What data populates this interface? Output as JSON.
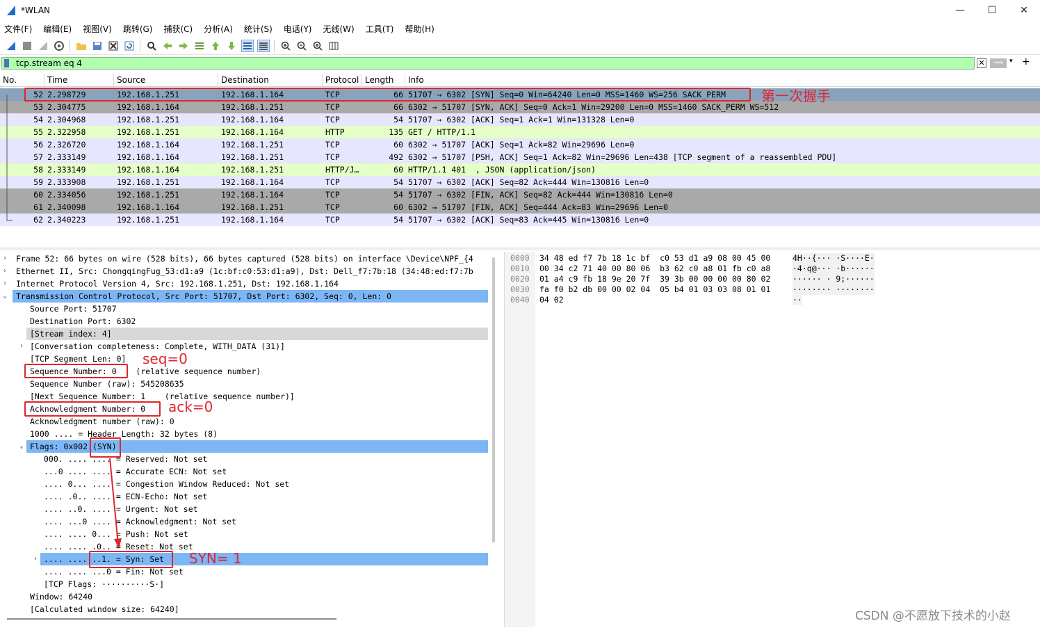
{
  "window": {
    "title": "*WLAN",
    "controls": [
      "—",
      "☐",
      "✕"
    ]
  },
  "menu": [
    "文件(F)",
    "编辑(E)",
    "视图(V)",
    "跳转(G)",
    "捕获(C)",
    "分析(A)",
    "统计(S)",
    "电话(Y)",
    "无线(W)",
    "工具(T)",
    "帮助(H)"
  ],
  "filter": {
    "value": "tcp.stream eq 4",
    "clear_glyph": "✕",
    "apply_glyph": "⟹",
    "dropdown_glyph": "▾",
    "add_glyph": "+"
  },
  "packet_list": {
    "columns": [
      "No.",
      "Time",
      "Source",
      "Destination",
      "Protocol",
      "Length",
      "Info"
    ],
    "rows": [
      {
        "no": "52",
        "time": "2.298729",
        "src": "192.168.1.251",
        "dst": "192.168.1.164",
        "proto": "TCP",
        "len": "66",
        "info": "51707 → 6302 [SYN] Seq=0 Win=64240 Len=0 MSS=1460 WS=256 SACK_PERM",
        "style": "selected"
      },
      {
        "no": "53",
        "time": "2.304775",
        "src": "192.168.1.164",
        "dst": "192.168.1.251",
        "proto": "TCP",
        "len": "66",
        "info": "6302 → 51707 [SYN, ACK] Seq=0 Ack=1 Win=29200 Len=0 MSS=1460 SACK_PERM WS=512",
        "style": "gray"
      },
      {
        "no": "54",
        "time": "2.304968",
        "src": "192.168.1.251",
        "dst": "192.168.1.164",
        "proto": "TCP",
        "len": "54",
        "info": "51707 → 6302 [ACK] Seq=1 Ack=1 Win=131328 Len=0",
        "style": "lavender"
      },
      {
        "no": "55",
        "time": "2.322958",
        "src": "192.168.1.251",
        "dst": "192.168.1.164",
        "proto": "HTTP",
        "len": "135",
        "info": "GET / HTTP/1.1",
        "style": "green"
      },
      {
        "no": "56",
        "time": "2.326720",
        "src": "192.168.1.164",
        "dst": "192.168.1.251",
        "proto": "TCP",
        "len": "60",
        "info": "6302 → 51707 [ACK] Seq=1 Ack=82 Win=29696 Len=0",
        "style": "lavender"
      },
      {
        "no": "57",
        "time": "2.333149",
        "src": "192.168.1.164",
        "dst": "192.168.1.251",
        "proto": "TCP",
        "len": "492",
        "info": "6302 → 51707 [PSH, ACK] Seq=1 Ack=82 Win=29696 Len=438 [TCP segment of a reassembled PDU]",
        "style": "lavender"
      },
      {
        "no": "58",
        "time": "2.333149",
        "src": "192.168.1.164",
        "dst": "192.168.1.251",
        "proto": "HTTP/J…",
        "len": "60",
        "info": "HTTP/1.1 401  , JSON (application/json)",
        "style": "green"
      },
      {
        "no": "59",
        "time": "2.333908",
        "src": "192.168.1.251",
        "dst": "192.168.1.164",
        "proto": "TCP",
        "len": "54",
        "info": "51707 → 6302 [ACK] Seq=82 Ack=444 Win=130816 Len=0",
        "style": "lavender"
      },
      {
        "no": "60",
        "time": "2.334056",
        "src": "192.168.1.251",
        "dst": "192.168.1.164",
        "proto": "TCP",
        "len": "54",
        "info": "51707 → 6302 [FIN, ACK] Seq=82 Ack=444 Win=130816 Len=0",
        "style": "gray"
      },
      {
        "no": "61",
        "time": "2.340098",
        "src": "192.168.1.164",
        "dst": "192.168.1.251",
        "proto": "TCP",
        "len": "60",
        "info": "6302 → 51707 [FIN, ACK] Seq=444 Ack=83 Win=29696 Len=0",
        "style": "gray"
      },
      {
        "no": "62",
        "time": "2.340223",
        "src": "192.168.1.251",
        "dst": "192.168.1.164",
        "proto": "TCP",
        "len": "54",
        "info": "51707 → 6302 [ACK] Seq=83 Ack=445 Win=130816 Len=0",
        "style": "lavender"
      }
    ]
  },
  "annotations": {
    "handshake": "第一次握手",
    "seq": "seq=0",
    "ack": "ack=0",
    "syn": "SYN= 1"
  },
  "details": [
    {
      "text": "Frame 52: 66 bytes on wire (528 bits), 66 bytes captured (528 bits) on interface \\Device\\NPF_{4",
      "indent": 0,
      "arrow": "›",
      "style": ""
    },
    {
      "text": "Ethernet II, Src: ChongqingFug_53:d1:a9 (1c:bf:c0:53:d1:a9), Dst: Dell_f7:7b:18 (34:48:ed:f7:7b",
      "indent": 0,
      "arrow": "›",
      "style": ""
    },
    {
      "text": "Internet Protocol Version 4, Src: 192.168.1.251, Dst: 192.168.1.164",
      "indent": 0,
      "arrow": "›",
      "style": ""
    },
    {
      "text": "Transmission Control Protocol, Src Port: 51707, Dst Port: 6302, Seq: 0, Len: 0",
      "indent": 0,
      "arrow": "⌄",
      "style": "blue"
    },
    {
      "text": "Source Port: 51707",
      "indent": 1,
      "arrow": "",
      "style": ""
    },
    {
      "text": "Destination Port: 6302",
      "indent": 1,
      "arrow": "",
      "style": ""
    },
    {
      "text": "[Stream index: 4]",
      "indent": 1,
      "arrow": "",
      "style": "gray"
    },
    {
      "text": "[Conversation completeness: Complete, WITH_DATA (31)]",
      "indent": 1,
      "arrow": "›",
      "style": ""
    },
    {
      "text": "[TCP Segment Len: 0]",
      "indent": 1,
      "arrow": "",
      "style": ""
    },
    {
      "text": "Sequence Number: 0    (relative sequence number)",
      "indent": 1,
      "arrow": "",
      "style": ""
    },
    {
      "text": "Sequence Number (raw): 545208635",
      "indent": 1,
      "arrow": "",
      "style": ""
    },
    {
      "text": "[Next Sequence Number: 1    (relative sequence number)]",
      "indent": 1,
      "arrow": "",
      "style": ""
    },
    {
      "text": "Acknowledgment Number: 0",
      "indent": 1,
      "arrow": "",
      "style": ""
    },
    {
      "text": "Acknowledgment number (raw): 0",
      "indent": 1,
      "arrow": "",
      "style": ""
    },
    {
      "text": "1000 .... = Header Length: 32 bytes (8)",
      "indent": 1,
      "arrow": "",
      "style": ""
    },
    {
      "text": "Flags: 0x002 (SYN)",
      "indent": 1,
      "arrow": "⌄",
      "style": "blue"
    },
    {
      "text": "000. .... .... = Reserved: Not set",
      "indent": 2,
      "arrow": "",
      "style": ""
    },
    {
      "text": "...0 .... .... = Accurate ECN: Not set",
      "indent": 2,
      "arrow": "",
      "style": ""
    },
    {
      "text": ".... 0... .... = Congestion Window Reduced: Not set",
      "indent": 2,
      "arrow": "",
      "style": ""
    },
    {
      "text": ".... .0.. .... = ECN-Echo: Not set",
      "indent": 2,
      "arrow": "",
      "style": ""
    },
    {
      "text": ".... ..0. .... = Urgent: Not set",
      "indent": 2,
      "arrow": "",
      "style": ""
    },
    {
      "text": ".... ...0 .... = Acknowledgment: Not set",
      "indent": 2,
      "arrow": "",
      "style": ""
    },
    {
      "text": ".... .... 0... = Push: Not set",
      "indent": 2,
      "arrow": "",
      "style": ""
    },
    {
      "text": ".... .... .0.. = Reset: Not set",
      "indent": 2,
      "arrow": "",
      "style": ""
    },
    {
      "text": ".... .... ..1. = Syn: Set",
      "indent": 2,
      "arrow": "›",
      "style": "blue"
    },
    {
      "text": ".... .... ...0 = Fin: Not set",
      "indent": 2,
      "arrow": "",
      "style": ""
    },
    {
      "text": "[TCP Flags: ··········S·]",
      "indent": 2,
      "arrow": "",
      "style": ""
    },
    {
      "text": "Window: 64240",
      "indent": 1,
      "arrow": "",
      "style": ""
    },
    {
      "text": "[Calculated window size: 64240]",
      "indent": 1,
      "arrow": "",
      "style": ""
    }
  ],
  "bytes": [
    {
      "offset": "0000",
      "hex": "34 48 ed f7 7b 18 1c bf  c0 53 d1 a9 08 00 45 00",
      "ascii": "4H··{··· ·S····E·"
    },
    {
      "offset": "0010",
      "hex": "00 34 c2 71 40 00 80 06  b3 62 c0 a8 01 fb c0 a8",
      "ascii": "·4·q@··· ·b······"
    },
    {
      "offset": "0020",
      "hex": "01 a4 c9 fb 18 9e 20 7f  39 3b 00 00 00 00 80 02",
      "ascii": "······ · 9;······"
    },
    {
      "offset": "0030",
      "hex": "fa f0 b2 db 00 00 02 04  05 b4 01 03 03 08 01 01",
      "ascii": "········ ········"
    },
    {
      "offset": "0040",
      "hex": "04 02",
      "ascii": "··"
    }
  ],
  "watermark": "CSDN @不愿放下技术的小赵",
  "colors": {
    "selected": "#8aa3bc",
    "gray": "#a9a9a9",
    "lavender": "#e7e6ff",
    "green": "#e4ffc7",
    "blue_sel": "#7db6f5",
    "annotation": "#e0262d"
  }
}
